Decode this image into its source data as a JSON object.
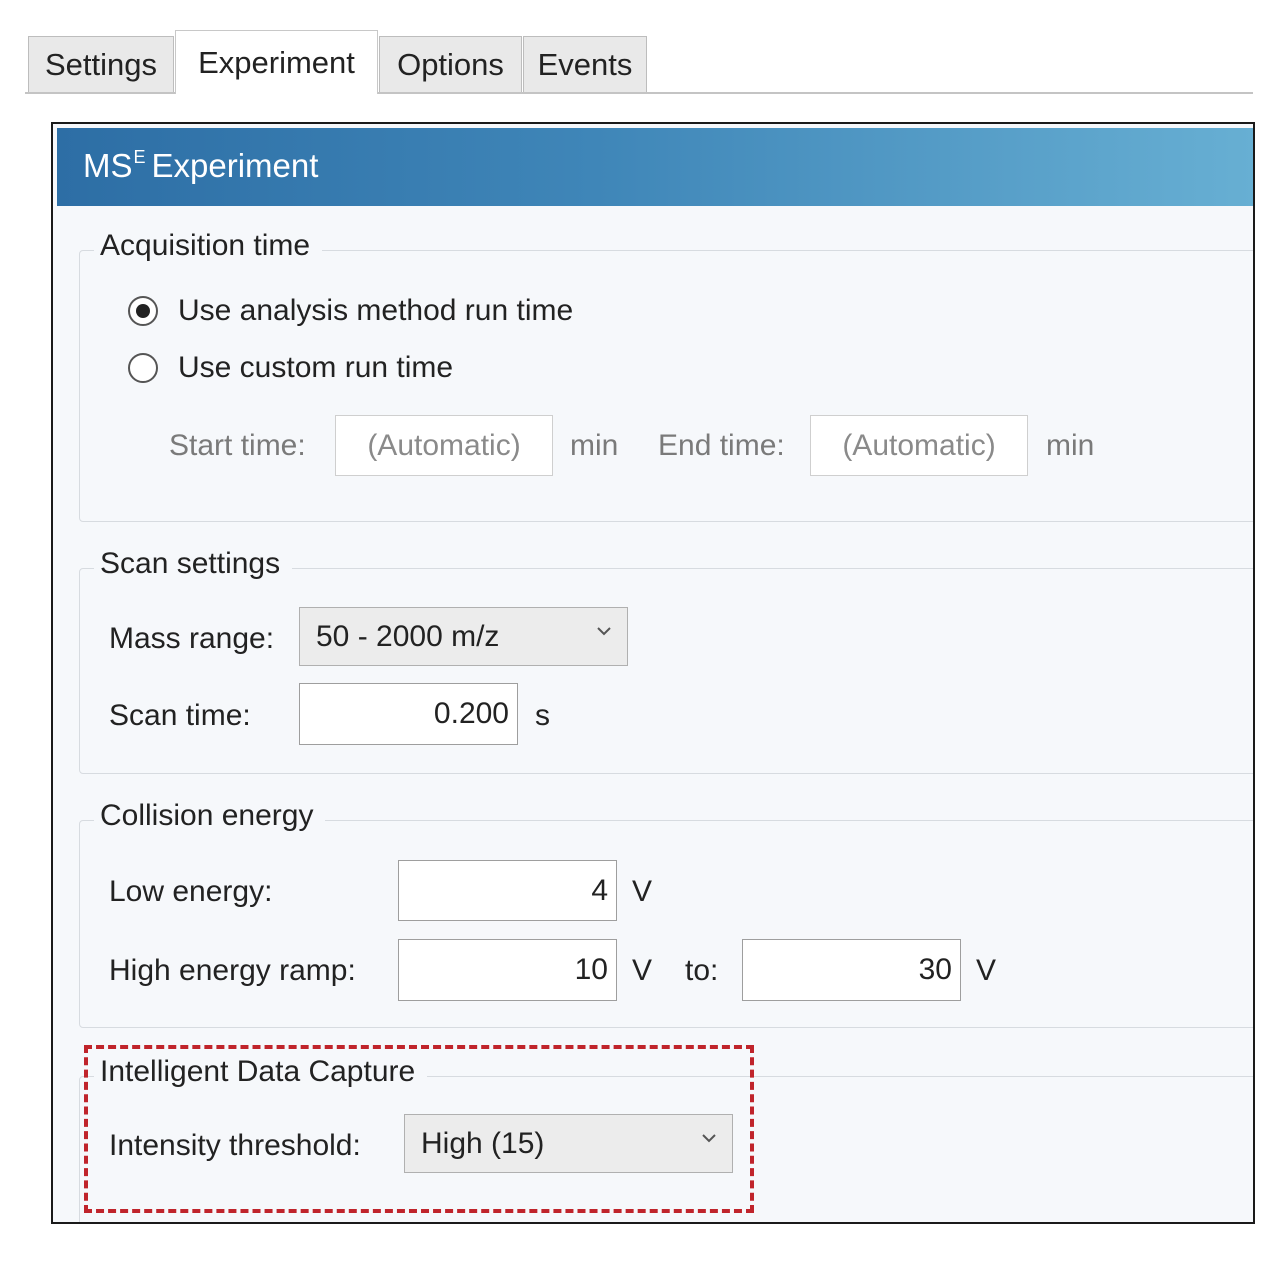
{
  "tabs": [
    {
      "label": "Settings",
      "active": false
    },
    {
      "label": "Experiment",
      "active": true
    },
    {
      "label": "Options",
      "active": false
    },
    {
      "label": "Events",
      "active": false
    }
  ],
  "panel": {
    "title_main": "MS",
    "title_sup": "E",
    "title_rest": "Experiment"
  },
  "acquisition": {
    "legend": "Acquisition time",
    "radio_method": {
      "label": "Use analysis method run time",
      "checked": true
    },
    "radio_custom": {
      "label": "Use custom run time",
      "checked": false
    },
    "start_label": "Start time:",
    "start_value": "(Automatic)",
    "start_unit": "min",
    "end_label": "End time:",
    "end_value": "(Automatic)",
    "end_unit": "min"
  },
  "scan": {
    "legend": "Scan settings",
    "mass_label": "Mass range:",
    "mass_value": "50 - 2000 m/z",
    "time_label": "Scan time:",
    "time_value": "0.200",
    "time_unit": "s"
  },
  "collision": {
    "legend": "Collision energy",
    "low_label": "Low energy:",
    "low_value": "4",
    "low_unit": "V",
    "high_label": "High energy ramp:",
    "high_from": "10",
    "high_from_unit": "V",
    "to_label": "to:",
    "high_to": "30",
    "high_to_unit": "V"
  },
  "idc": {
    "legend": "Intelligent Data Capture",
    "threshold_label": "Intensity threshold:",
    "threshold_value": "High (15)"
  },
  "colors": {
    "header_gradient": [
      "#2d6ea5",
      "#67afd3"
    ],
    "highlight": "#c0242b",
    "panel_bg": "#f6f8fb"
  }
}
